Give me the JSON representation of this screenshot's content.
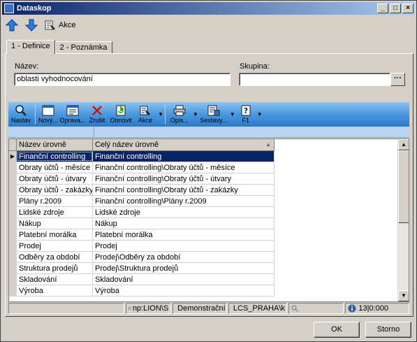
{
  "window": {
    "title": "Dataskop"
  },
  "toolbar": {
    "akce": "Akce"
  },
  "tabs": [
    {
      "label": "1 - Definice"
    },
    {
      "label": "2 - Poznámka"
    }
  ],
  "form": {
    "nazev_label": "Název:",
    "nazev_value": "oblasti vyhodnocování",
    "skupina_label": "Skupina:",
    "skupina_value": "",
    "dots": "···"
  },
  "grid_toolbar": [
    {
      "label": "Nastav"
    },
    {
      "label": "Nový..."
    },
    {
      "label": "Oprava..."
    },
    {
      "label": "Zrušit"
    },
    {
      "label": "Obnovit"
    },
    {
      "label": "Akce"
    },
    {
      "label": "Opis..."
    },
    {
      "label": "Sestavy..."
    },
    {
      "label": "F1"
    }
  ],
  "table": {
    "headers": [
      "Název úrovně",
      "Celý název úrovně"
    ],
    "rows": [
      [
        "Finanční controlling",
        "Finanční controlling"
      ],
      [
        "Obraty účtů - měsíce",
        "Finanční controlling\\Obraty účtů - měsíce"
      ],
      [
        "Obraty účtů - útvary",
        "Finanční controlling\\Obraty účtů - útvary"
      ],
      [
        "Obraty účtů - zakázky",
        "Finanční controlling\\Obraty účtů - zakázky"
      ],
      [
        "Plány r.2009",
        "Finanční controlling\\Plány r.2009"
      ],
      [
        "Lidské zdroje",
        "Lidské zdroje"
      ],
      [
        "Nákup",
        "Nákup"
      ],
      [
        "Platební morálka",
        "Platební morálka"
      ],
      [
        "Prodej",
        "Prodej"
      ],
      [
        "Odběry za období",
        "Prodej\\Odběry za období"
      ],
      [
        "Struktura prodejů",
        "Prodej\\Struktura prodejů"
      ],
      [
        "Skladování",
        "Skladování"
      ],
      [
        "Výroba",
        "Výroba"
      ]
    ]
  },
  "status": {
    "server": "np:LION\\S",
    "db": "Demonstrační",
    "user": "LCS_PRAHA\\k",
    "count": "13|0:000"
  },
  "buttons": {
    "ok": "OK",
    "storno": "Storno"
  }
}
